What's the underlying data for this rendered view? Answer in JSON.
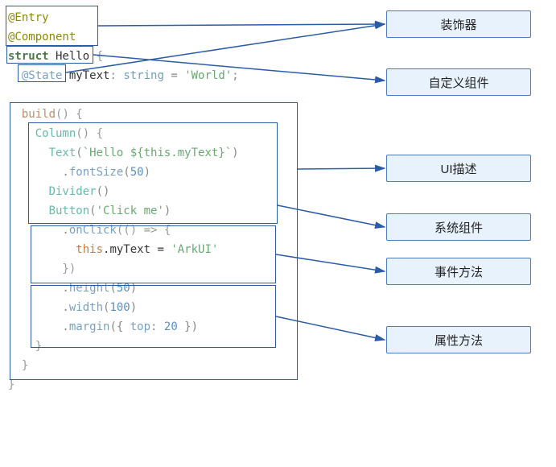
{
  "code": {
    "l1": "@Entry",
    "l2": "@Component",
    "l3a": "struct",
    "l3b": " Hello",
    "l3c": " {",
    "l4a": "  @State",
    "l4b": " myText",
    "l4c": ": ",
    "l4d": "string",
    "l4e": " = ",
    "l4f": "'World'",
    "l4g": ";",
    "l5": "",
    "l6a": "  build",
    "l6b": "() {",
    "l7a": "    Column",
    "l7b": "() {",
    "l8a": "      Text",
    "l8b": "(",
    "l8c": "`Hello ${this.myText}`",
    "l8d": ")",
    "l9a": "        .",
    "l9b": "fontSize",
    "l9c": "(",
    "l9d": "50",
    "l9e": ")",
    "l10a": "      Divider",
    "l10b": "()",
    "l11a": "      Button",
    "l11b": "(",
    "l11c": "'Click me'",
    "l11d": ")",
    "l12a": "        .",
    "l12b": "onClick",
    "l12c": "(() => {",
    "l13a": "          this",
    "l13b": ".myText = ",
    "l13c": "'ArkUI'",
    "l14": "        })",
    "l15a": "        .",
    "l15b": "height",
    "l15c": "(",
    "l15d": "50",
    "l15e": ")",
    "l16a": "        .",
    "l16b": "width",
    "l16c": "(",
    "l16d": "100",
    "l16e": ")",
    "l17a": "        .",
    "l17b": "margin",
    "l17c": "({ ",
    "l17d": "top",
    "l17e": ": ",
    "l17f": "20",
    "l17g": " })",
    "l18": "    }",
    "l19": "  }",
    "l20": "}"
  },
  "labels": {
    "decorator": "装饰器",
    "customComp": "自定义组件",
    "uiDesc": "UI描述",
    "sysComp": "系统组件",
    "eventMethod": "事件方法",
    "attrMethod": "属性方法"
  }
}
